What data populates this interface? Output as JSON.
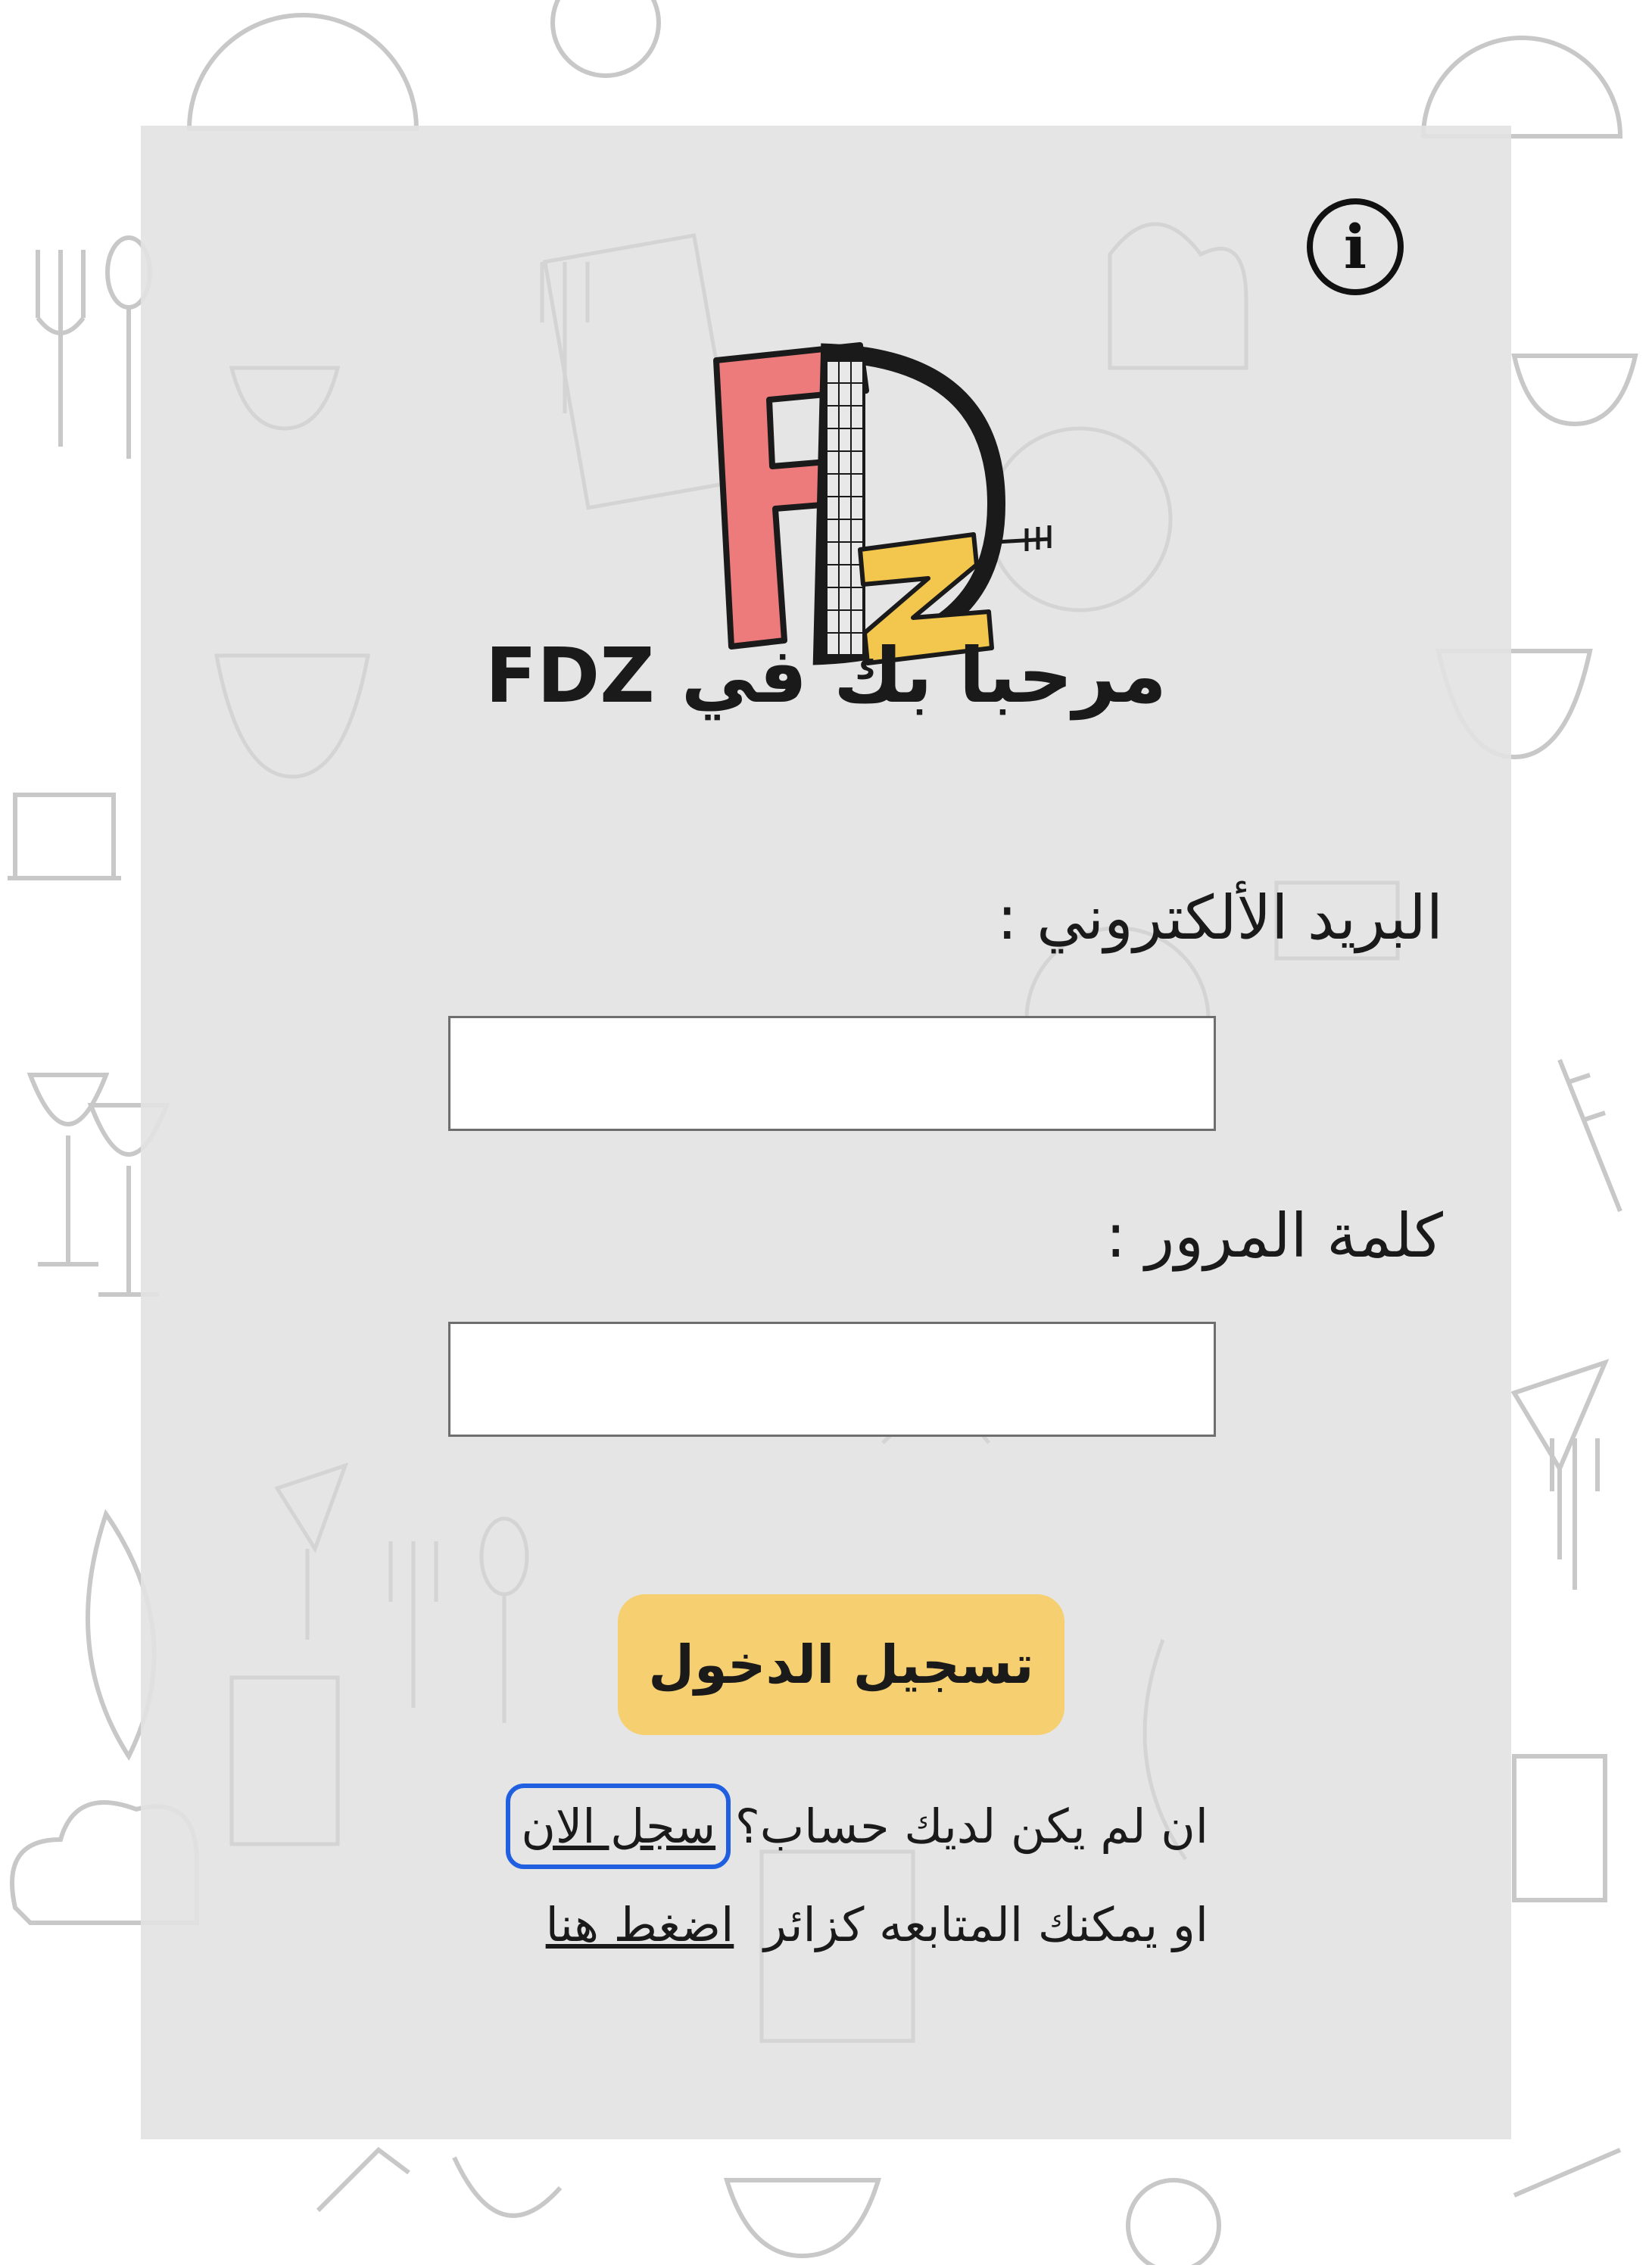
{
  "app": {
    "name": "FDZ"
  },
  "header": {
    "info_icon_glyph": "i",
    "welcome_title": "مرحبا بك في FDZ"
  },
  "logo": {
    "colors": {
      "f": "#ee7b7b",
      "d": "#1a1a1a",
      "z": "#f3c64d"
    }
  },
  "form": {
    "email_label": "البريد الألكتروني :",
    "email_value": "",
    "password_label": "كلمة المرور :",
    "password_value": "",
    "login_button_label": "تسجيل الدخول"
  },
  "footer": {
    "no_account_text": "ان لم يكن لديك حساب؟",
    "signup_link": "سجل الان",
    "guest_text": "او يمكنك المتابعه كزائر",
    "guest_link": "اضغط هنا"
  },
  "colors": {
    "card_background": "#e2e2e2",
    "button_background": "#f5cf70",
    "highlight_outline": "#1f5fe0"
  }
}
